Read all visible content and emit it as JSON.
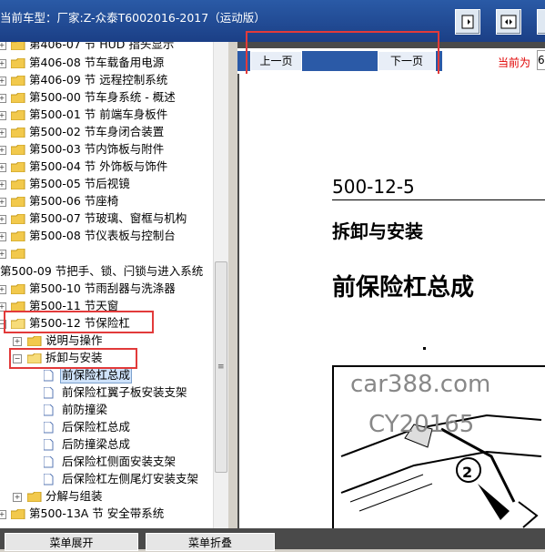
{
  "title": "当前车型：厂家:Z-众泰T6002016-2017（运动版）",
  "toolbar": {
    "icons": [
      "fit-page-icon",
      "fit-width-icon",
      "next-icon"
    ]
  },
  "nav": {
    "prev_label": "上一页",
    "next_label": "下一页",
    "current_label": "当前为",
    "page_value": "6"
  },
  "tree": {
    "items": [
      {
        "label": "第406-07 节 HUD 指头显示"
      },
      {
        "label": "第406-08 节车载备用电源"
      },
      {
        "label": "第406-09 节 远程控制系统"
      },
      {
        "label": "第500-00 节车身系统 - 概述"
      },
      {
        "label": "第500-01 节 前端车身板件"
      },
      {
        "label": "第500-02 节车身闭合装置"
      },
      {
        "label": "第500-03 节内饰板与附件"
      },
      {
        "label": "第500-04 节 外饰板与饰件"
      },
      {
        "label": "第500-05 节后视镜"
      },
      {
        "label": "第500-06 节座椅"
      },
      {
        "label": "第500-07 节玻璃、窗框与机构"
      },
      {
        "label": "第500-08 节仪表板与控制台"
      },
      {
        "label": ""
      },
      {
        "label": "第500-09 节把手、锁、闩锁与进入系统"
      },
      {
        "label": "第500-10 节雨刮器与洗涤器"
      },
      {
        "label": "第500-11 节天窗"
      },
      {
        "label": "第500-12 节保险杠"
      },
      {
        "label": "说明与操作"
      },
      {
        "label": "拆卸与安装"
      },
      {
        "label": "前保险杠总成"
      },
      {
        "label": "前保险杠翼子板安装支架"
      },
      {
        "label": "前防撞梁"
      },
      {
        "label": "后保险杠总成"
      },
      {
        "label": "后防撞梁总成"
      },
      {
        "label": "后保险杠侧面安装支架"
      },
      {
        "label": "后保险杠左侧尾灯安装支架"
      },
      {
        "label": "分解与组装"
      },
      {
        "label": "第500-13A 节 安全带系统"
      }
    ]
  },
  "doc": {
    "section_number": "500-12-5",
    "heading": "拆卸与安装",
    "title": "前保险杠总成",
    "watermark1": "car388.com",
    "watermark2": "CY20165",
    "callout": "2"
  },
  "bottom": {
    "expand_label": "菜单展开",
    "collapse_label": "菜单折叠"
  },
  "colors": {
    "titlebar": "#1e4690",
    "highlight": "#e23a3a",
    "selected": "#cfe3fb"
  }
}
